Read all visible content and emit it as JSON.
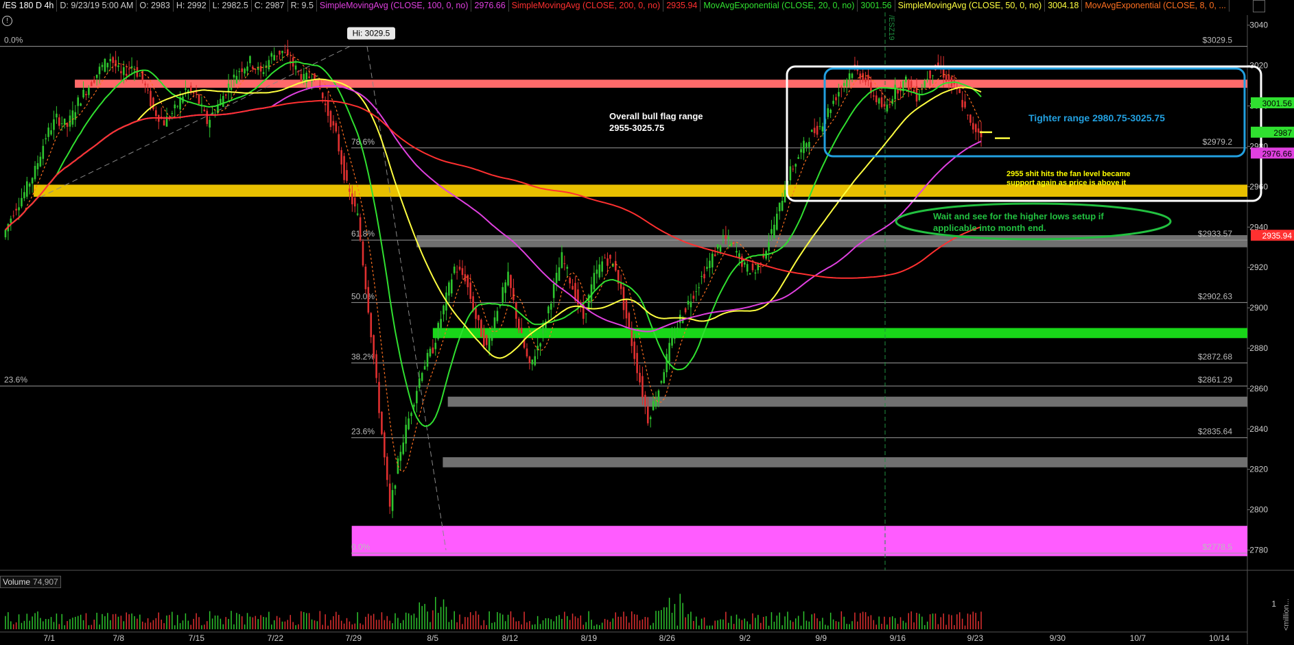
{
  "header": {
    "symbol": "/ES 180 D 4h",
    "date": "D: 9/23/19 5:00 AM",
    "open": "O: 2983",
    "high": "H: 2992",
    "low": "L: 2982.5",
    "close": "C: 2987",
    "range": "R: 9.5",
    "studies": [
      {
        "label": "SimpleMovingAvg (CLOSE, 100, 0, no)",
        "value": "2976.66",
        "color": "#e040e0"
      },
      {
        "label": "SimpleMovingAvg (CLOSE, 200, 0, no)",
        "value": "2935.94",
        "color": "#ff3030"
      },
      {
        "label": "MovAvgExponential (CLOSE, 20, 0, no)",
        "value": "3001.56",
        "color": "#30e030"
      },
      {
        "label": "SimpleMovingAvg (CLOSE, 50, 0, no)",
        "value": "3004.18",
        "color": "#ffff40"
      },
      {
        "label": "MovAvgExponential (CLOSE, 8, 0, ...",
        "value": "",
        "color": "#ff7020"
      }
    ]
  },
  "hi_label": "Hi: 3029.5",
  "vertical_marker": "/ESZ19",
  "volume": {
    "label": "Volume",
    "value": "74,907",
    "ticks": [
      "1"
    ],
    "unit": "<million..."
  },
  "annotations": {
    "bull_flag": {
      "line1": "Overall bull flag range",
      "line2": "2955-3025.75"
    },
    "tighter": "Tighter range 2980.75-3025.75",
    "fan": {
      "line1": "2955 shit hits the fan level became",
      "line2": "support again as price is above it"
    },
    "wait": {
      "line1": "Wait and see for the higher lows setup if",
      "line2": "applicable into month end."
    }
  },
  "colors": {
    "bull_flag": "#ffffff",
    "tighter": "#22a0e0",
    "fan": "#ffff00",
    "wait": "#22c040",
    "resistance_band": "#ff6a6a",
    "support_yellow": "#e8c000",
    "support_green": "#19d619",
    "grey_band": "#707070",
    "magenta_band": "#ff5cff"
  },
  "chart_data": {
    "type": "candlestick",
    "ylim": [
      2770,
      3045
    ],
    "y_ticks": [
      3040,
      3020,
      3000,
      2980,
      2960,
      2940,
      2920,
      2900,
      2880,
      2860,
      2840,
      2820,
      2800,
      2780
    ],
    "x_ticks": [
      "7/1",
      "7/8",
      "7/15",
      "7/22",
      "7/29",
      "8/5",
      "8/12",
      "8/19",
      "8/26",
      "9/2",
      "9/9",
      "9/16",
      "9/23",
      "9/30",
      "10/7",
      "10/14"
    ],
    "fib_levels": [
      {
        "label": "0.0%",
        "price": 3029.5,
        "value": "$3029.5"
      },
      {
        "label": "78.6%",
        "price": 2979.2,
        "value": "$2979.2"
      },
      {
        "label": "61.8%",
        "price": 2933.57,
        "value": "$2933.57"
      },
      {
        "label": "50.0%",
        "price": 2902.63,
        "value": "$2902.63"
      },
      {
        "label": "38.2%",
        "price": 2872.68,
        "value": "$2872.68"
      },
      {
        "label": "23.6%",
        "price": 2835.64,
        "value": "$2835.64"
      },
      {
        "label": "0.0%",
        "price": 2778.5,
        "value": "$2778.5"
      }
    ],
    "left_fib": {
      "label": "23.6%",
      "price": 2861.29,
      "value": "$2861.29"
    },
    "price_tags": [
      {
        "value": "3001.56",
        "price": 3001.56,
        "bg": "#30e030",
        "fg": "#000"
      },
      {
        "value": "2987",
        "price": 2987,
        "bg": "#30e030",
        "fg": "#000"
      },
      {
        "value": "2976.66",
        "price": 2976.66,
        "bg": "#e040e0",
        "fg": "#000"
      },
      {
        "value": "2935.94",
        "price": 2935.94,
        "bg": "#ff3030",
        "fg": "#fff"
      }
    ],
    "bands": [
      {
        "name": "resistance-band",
        "from": 3009,
        "to": 3013,
        "x0": 0.06,
        "x1": 1.0,
        "color": "#ff6a6a"
      },
      {
        "name": "support-yellow-band",
        "from": 2955,
        "to": 2961,
        "x0": 0.027,
        "x1": 1.0,
        "color": "#e8c000"
      },
      {
        "name": "grey-band-2935",
        "from": 2930,
        "to": 2936,
        "x0": 0.334,
        "x1": 1.0,
        "color": "#707070"
      },
      {
        "name": "green-band-2890",
        "from": 2885,
        "to": 2890,
        "x0": 0.347,
        "x1": 1.0,
        "color": "#19d619"
      },
      {
        "name": "grey-band-2855",
        "from": 2851,
        "to": 2856,
        "x0": 0.359,
        "x1": 1.0,
        "color": "#707070"
      },
      {
        "name": "grey-band-2825",
        "from": 2821,
        "to": 2826,
        "x0": 0.355,
        "x1": 1.0,
        "color": "#707070"
      },
      {
        "name": "magenta-band",
        "from": 2777,
        "to": 2792,
        "x0": 0.282,
        "x1": 1.0,
        "color": "#ff5cff"
      }
    ],
    "series_close": [
      2935,
      2948,
      2957,
      2968,
      2985,
      2994,
      2990,
      3002,
      3010,
      3018,
      3024,
      3015,
      3020,
      3013,
      2998,
      2992,
      2998,
      3008,
      3005,
      2992,
      3000,
      3010,
      3018,
      3022,
      3016,
      3025,
      3027,
      3020,
      3013,
      3016,
      3000,
      2985,
      2960,
      2945,
      2900,
      2850,
      2800,
      2830,
      2850,
      2870,
      2880,
      2900,
      2920,
      2915,
      2895,
      2880,
      2900,
      2915,
      2890,
      2870,
      2885,
      2905,
      2925,
      2910,
      2895,
      2915,
      2925,
      2920,
      2895,
      2870,
      2845,
      2860,
      2880,
      2895,
      2905,
      2915,
      2925,
      2935,
      2930,
      2920,
      2918,
      2930,
      2945,
      2965,
      2975,
      2985,
      2990,
      3000,
      3010,
      3018,
      3015,
      3005,
      2998,
      3008,
      3012,
      3005,
      3015,
      3020,
      3012,
      3005,
      2990,
      2987
    ]
  }
}
